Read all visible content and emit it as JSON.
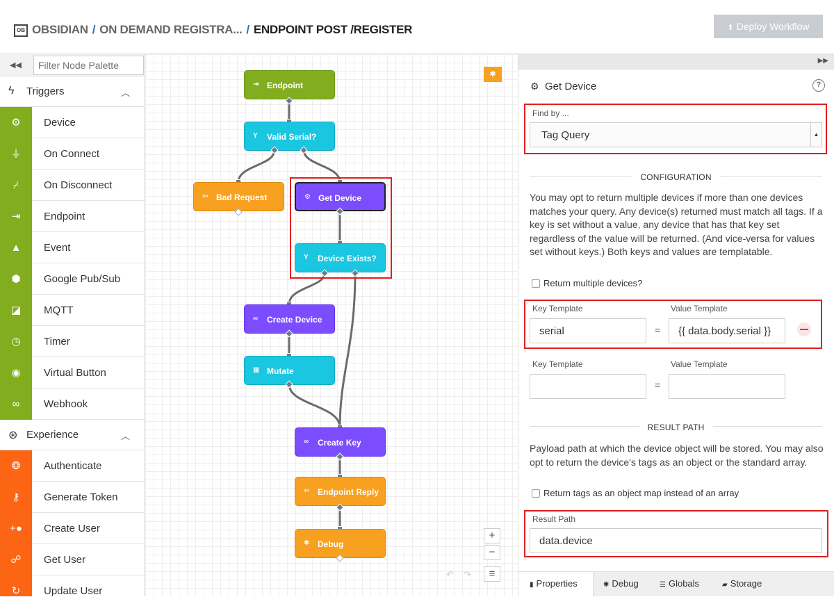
{
  "header": {
    "logo_text": "OB",
    "breadcrumb": [
      "OBSIDIAN",
      "ON DEMAND REGISTRA...",
      "ENDPOINT POST /REGISTER"
    ],
    "separator": "/",
    "deploy_label": "Deploy Workflow"
  },
  "palette": {
    "filter_placeholder": "Filter Node Palette",
    "triggers": {
      "label": "Triggers",
      "items": [
        {
          "label": "Device",
          "icon": "chip-icon"
        },
        {
          "label": "On Connect",
          "icon": "plug-icon"
        },
        {
          "label": "On Disconnect",
          "icon": "unplug-icon"
        },
        {
          "label": "Endpoint",
          "icon": "endpoint-icon"
        },
        {
          "label": "Event",
          "icon": "warning-icon"
        },
        {
          "label": "Google Pub/Sub",
          "icon": "pubsub-icon"
        },
        {
          "label": "MQTT",
          "icon": "mqtt-icon"
        },
        {
          "label": "Timer",
          "icon": "timer-icon"
        },
        {
          "label": "Virtual Button",
          "icon": "button-icon"
        },
        {
          "label": "Webhook",
          "icon": "link-icon"
        }
      ]
    },
    "experience": {
      "label": "Experience",
      "items": [
        {
          "label": "Authenticate",
          "icon": "fingerprint-icon"
        },
        {
          "label": "Generate Token",
          "icon": "key-icon"
        },
        {
          "label": "Create User",
          "icon": "add-user-icon"
        },
        {
          "label": "Get User",
          "icon": "user-walk-icon"
        },
        {
          "label": "Update User",
          "icon": "refresh-user-icon"
        }
      ]
    }
  },
  "canvas": {
    "nodes": {
      "endpoint": "Endpoint",
      "valid_serial": "Valid Serial?",
      "bad_request": "Bad Request",
      "get_device": "Get Device",
      "device_exists": "Device Exists?",
      "create_device": "Create Device",
      "mutate": "Mutate",
      "create_key": "Create Key",
      "endpoint_reply": "Endpoint Reply",
      "debug": "Debug"
    },
    "zoom_in": "+",
    "zoom_out": "−",
    "menu": "≡"
  },
  "properties": {
    "title": "Get Device",
    "help": "?",
    "find_by_label": "Find by ...",
    "find_by_value": "Tag Query",
    "configuration_heading": "CONFIGURATION",
    "configuration_text": "You may opt to return multiple devices if more than one devices matches your query. Any device(s) returned must match all tags. If a key is set without a value, any device that has that key set regardless of the value will be returned. (And vice-versa for values set without keys.) Both keys and values are templatable.",
    "return_multiple_label": "Return multiple devices?",
    "key_template_label": "Key Template",
    "value_template_label": "Value Template",
    "tag_rows": [
      {
        "key": "serial",
        "value": "{{ data.body.serial }}"
      },
      {
        "key": "",
        "value": ""
      }
    ],
    "equals": "=",
    "result_path_heading": "RESULT PATH",
    "result_path_text": "Payload path at which the device object will be stored. You may also opt to return the device's tags as an object or the standard array.",
    "return_tags_label": "Return tags as an object map instead of an array",
    "result_path_label": "Result Path",
    "result_path_value": "data.device"
  },
  "tabs": [
    {
      "label": "Properties",
      "active": true
    },
    {
      "label": "Debug",
      "active": false
    },
    {
      "label": "Globals",
      "active": false
    },
    {
      "label": "Storage",
      "active": false
    }
  ]
}
